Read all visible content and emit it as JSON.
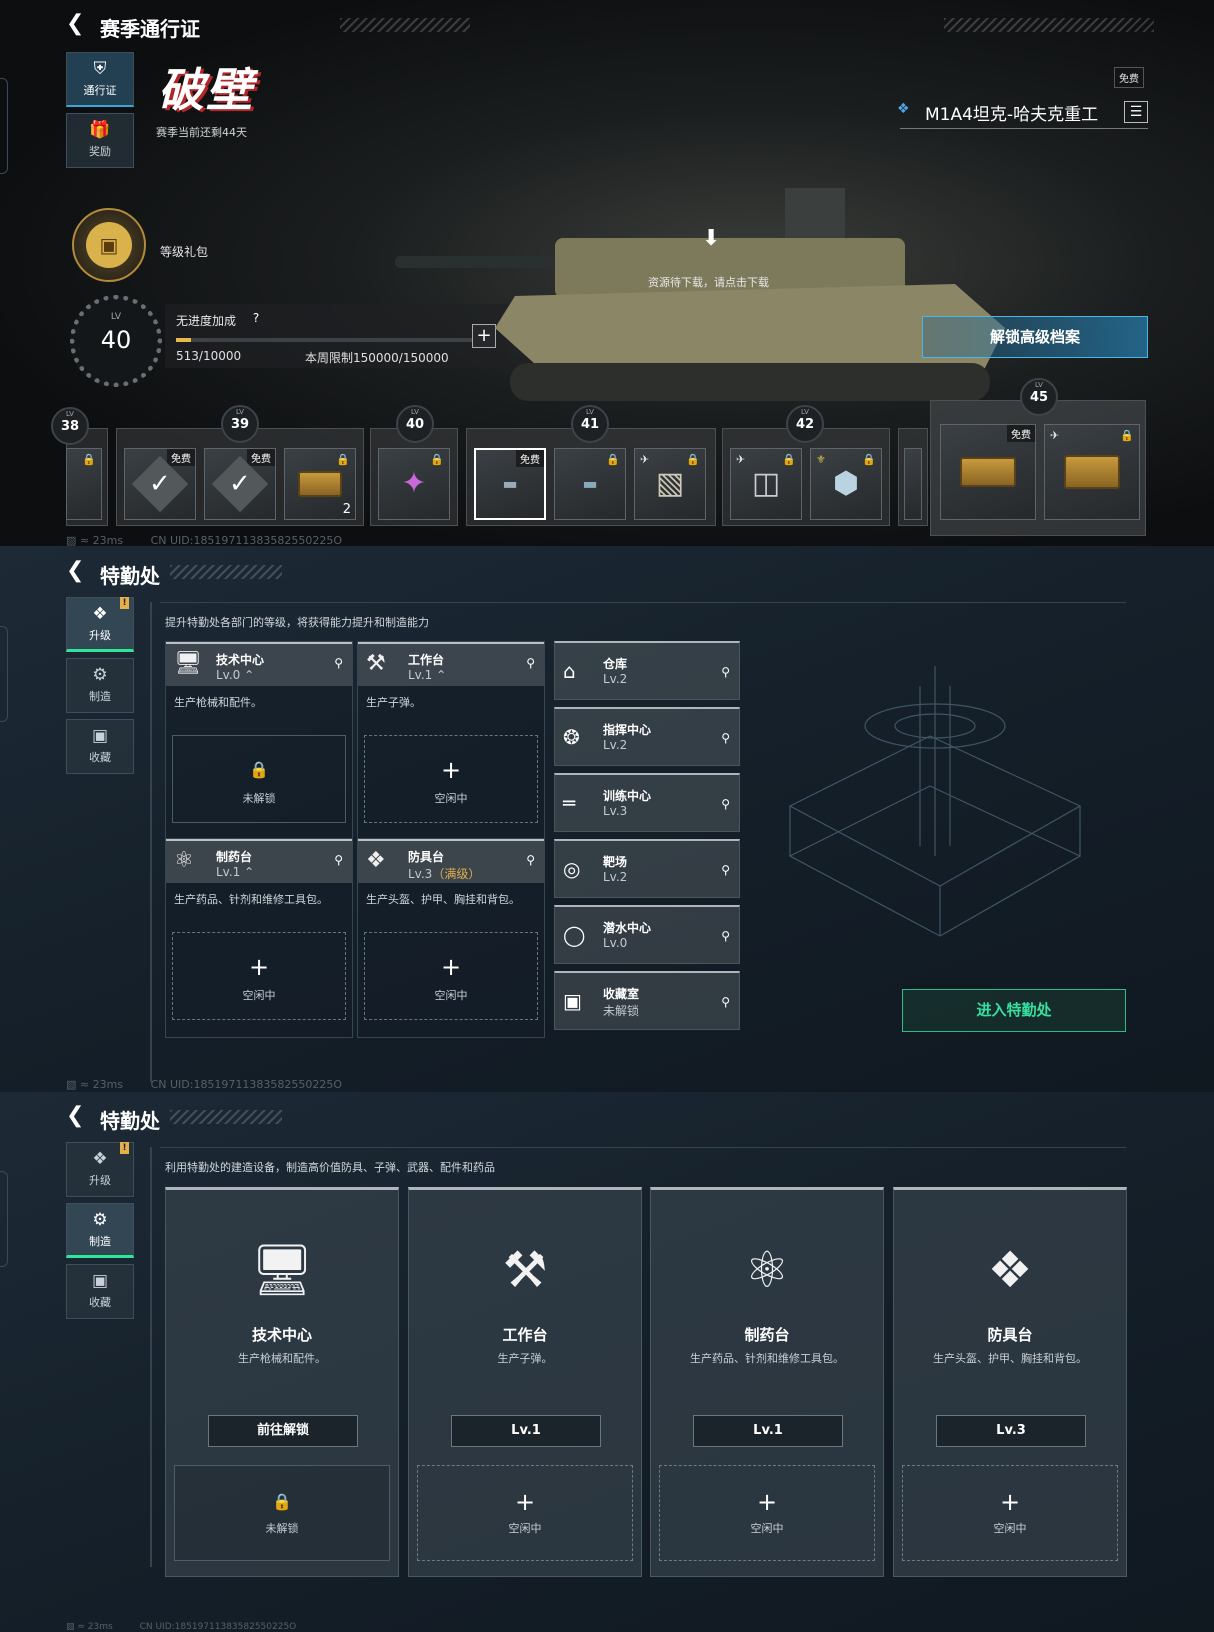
{
  "pass": {
    "back_icon": "back-chevron-icon",
    "title": "赛季通行证",
    "nav": [
      {
        "label": "通行证",
        "icon": "shield-icon",
        "active": true
      },
      {
        "label": "奖励",
        "icon": "gift-icon",
        "active": false
      }
    ],
    "season_logo": "破壁",
    "season_remaining": "赛季当前还剩44天",
    "level_gift_label": "等级礼包",
    "level_label": "LV",
    "level": "40",
    "bonus_label": "无进度加成",
    "help_icon": "?",
    "progress_text": "513/10000",
    "progress_fraction": 0.0513,
    "weekly_limit": "本周限制150000/150000",
    "plus_icon": "+",
    "download_hint": "资源待下载，请点击下载",
    "free_badge": "免费",
    "featured_name": "M1A4坦克-哈夫克重工",
    "unlock_button": "解锁高级档案",
    "milestones": [
      "38",
      "39",
      "40",
      "41",
      "42",
      "45"
    ],
    "reward_count": "2",
    "status_bar": "23ms",
    "uid": "CN UID:18519711383582550225O"
  },
  "ops": {
    "title": "特勤处",
    "nav": [
      {
        "label": "升级",
        "icon": "upgrade-icon"
      },
      {
        "label": "制造",
        "icon": "craft-gear-icon"
      },
      {
        "label": "收藏",
        "icon": "collection-icon"
      }
    ],
    "subtitle": "提升特勤处各部门的等级，将获得能力提升和制造能力",
    "departments": [
      {
        "name": "技术中心",
        "level": "Lv.0",
        "desc": "生产枪械和配件。",
        "slot": "未解锁",
        "locked": true
      },
      {
        "name": "工作台",
        "level": "Lv.1",
        "desc": "生产子弹。",
        "slot": "空闲中",
        "locked": false
      },
      {
        "name": "制药台",
        "level": "Lv.1",
        "desc": "生产药品、针剂和维修工具包。",
        "slot": "空闲中",
        "locked": false
      },
      {
        "name": "防具台",
        "level": "Lv.3",
        "level_extra": "（满级）",
        "desc": "生产头盔、护甲、胸挂和背包。",
        "slot": "空闲中",
        "locked": false
      }
    ],
    "facilities": [
      {
        "name": "仓库",
        "level": "Lv.2"
      },
      {
        "name": "指挥中心",
        "level": "Lv.2"
      },
      {
        "name": "训练中心",
        "level": "Lv.3"
      },
      {
        "name": "靶场",
        "level": "Lv.2"
      },
      {
        "name": "潜水中心",
        "level": "Lv.0"
      },
      {
        "name": "收藏室",
        "level": "未解锁"
      }
    ],
    "enter_button": "进入特勤处",
    "status_bar": "23ms",
    "uid": "CN UID:18519711383582550225O"
  },
  "craft": {
    "title": "特勤处",
    "subtitle": "利用特勤处的建造设备，制造高价值防具、子弹、武器、配件和药品",
    "stations": [
      {
        "name": "技术中心",
        "desc": "生产枪械和配件。",
        "button": "前往解锁",
        "slot": "未解锁",
        "locked": true,
        "icon": "monitor-icon"
      },
      {
        "name": "工作台",
        "desc": "生产子弹。",
        "button": "Lv.1",
        "slot": "空闲中",
        "locked": false,
        "icon": "tools-icon"
      },
      {
        "name": "制药台",
        "desc": "生产药品、针剂和维修工具包。",
        "button": "Lv.1",
        "slot": "空闲中",
        "locked": false,
        "icon": "microscope-icon"
      },
      {
        "name": "防具台",
        "desc": "生产头盔、护甲、胸挂和背包。",
        "button": "Lv.3",
        "slot": "空闲中",
        "locked": false,
        "icon": "cubes-icon"
      }
    ],
    "status_bar": "23ms",
    "uid": "CN UID:18519711383582550225O"
  }
}
